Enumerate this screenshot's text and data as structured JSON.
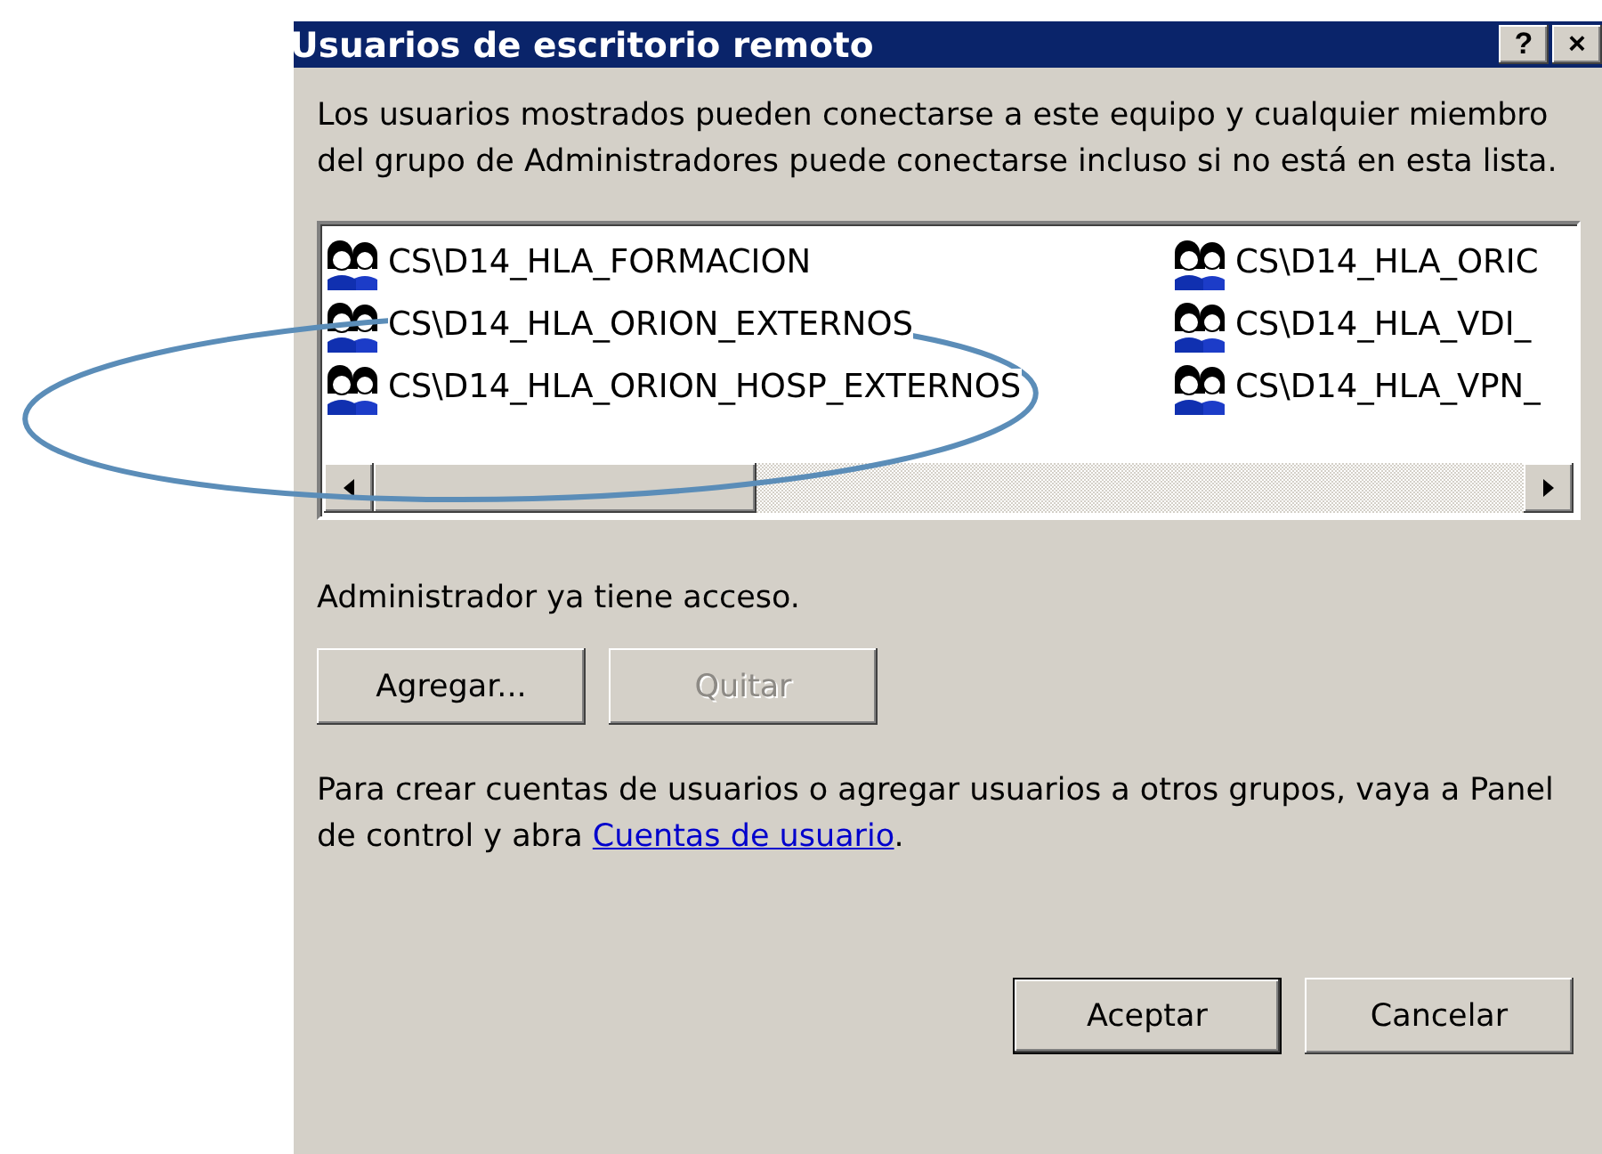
{
  "window": {
    "title": "Usuarios de escritorio remoto",
    "help_button": "?",
    "close_button": "×"
  },
  "description": "Los usuarios mostrados pueden conectarse a este equipo y cualquier miembro del grupo de Administradores puede conectarse incluso si no está en esta lista.",
  "user_list": {
    "columns": [
      [
        "CS\\D14_HLA_FORMACION",
        "CS\\D14_HLA_ORION_EXTERNOS",
        "CS\\D14_HLA_ORION_HOSP_EXTERNOS"
      ],
      [
        "CS\\D14_HLA_ORIC",
        "CS\\D14_HLA_VDI_",
        "CS\\D14_HLA_VPN_"
      ]
    ]
  },
  "access_note": "Administrador ya tiene acceso.",
  "list_buttons": [
    {
      "label": "Agregar...",
      "disabled": false
    },
    {
      "label": "Quitar",
      "disabled": true
    }
  ],
  "info": {
    "text": "Para crear cuentas de usuarios o agregar usuarios a otros grupos, vaya a Panel de control y abra ",
    "link": "Cuentas de usuario",
    "suffix": "."
  },
  "dialog_buttons": [
    {
      "label": "Aceptar",
      "default": true
    },
    {
      "label": "Cancelar",
      "default": false
    }
  ]
}
